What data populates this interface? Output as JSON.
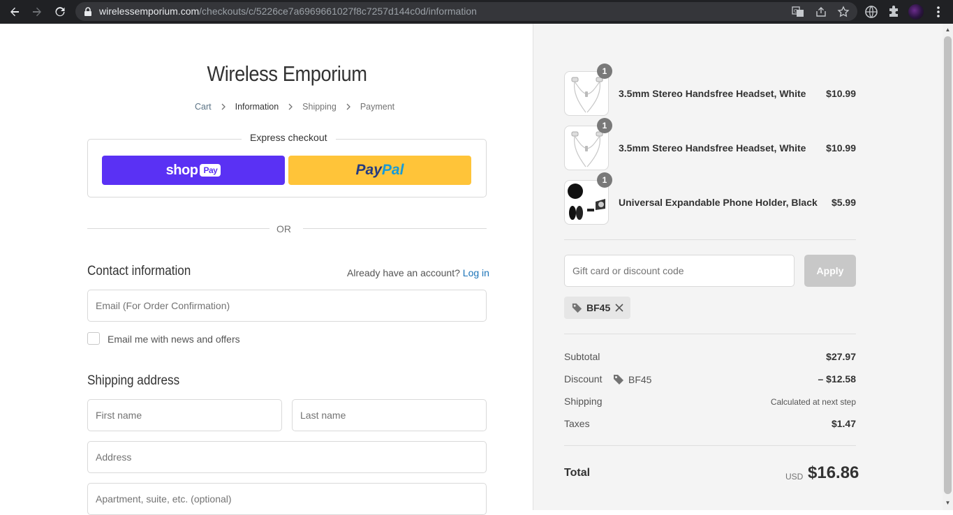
{
  "browser": {
    "url_host": "wirelessemporium.com",
    "url_path": "/checkouts/c/5226ce7a6969661027f8c7257d144c0d/information"
  },
  "shop": {
    "title": "Wireless Emporium"
  },
  "breadcrumb": {
    "cart": "Cart",
    "information": "Information",
    "shipping": "Shipping",
    "payment": "Payment"
  },
  "express": {
    "label": "Express checkout",
    "shoppay_text": "shop",
    "shoppay_badge": "Pay",
    "paypal_part1": "Pay",
    "paypal_part2": "Pal"
  },
  "or_text": "OR",
  "contact": {
    "title": "Contact information",
    "have_account": "Already have an account?",
    "login_link": "Log in",
    "email_placeholder": "Email (For Order Confirmation)",
    "email_value": "",
    "newsletter_label": "Email me with news and offers",
    "newsletter_checked": false
  },
  "shipping": {
    "title": "Shipping address",
    "first_name_placeholder": "First name",
    "last_name_placeholder": "Last name",
    "address_placeholder": "Address",
    "apartment_placeholder": "Apartment, suite, etc. (optional)"
  },
  "cart_items": [
    {
      "name": "3.5mm Stereo Handsfree Headset, White",
      "price": "$10.99",
      "qty": "1"
    },
    {
      "name": "3.5mm Stereo Handsfree Headset, White",
      "price": "$10.99",
      "qty": "1"
    },
    {
      "name": "Universal Expandable Phone Holder, Black",
      "price": "$5.99",
      "qty": "1"
    }
  ],
  "discount": {
    "placeholder": "Gift card or discount code",
    "apply_label": "Apply",
    "applied_code": "BF45"
  },
  "summary": {
    "subtotal_label": "Subtotal",
    "subtotal_value": "$27.97",
    "discount_label": "Discount",
    "discount_code": "BF45",
    "discount_value": "– $12.58",
    "shipping_label": "Shipping",
    "shipping_value": "Calculated at next step",
    "taxes_label": "Taxes",
    "taxes_value": "$1.47",
    "total_label": "Total",
    "total_currency": "USD",
    "total_value": "$16.86"
  },
  "colors": {
    "shoppay": "#5a31f4",
    "paypal": "#ffc439",
    "link": "#1a73b8",
    "apply_disabled": "#c8c8c8"
  }
}
